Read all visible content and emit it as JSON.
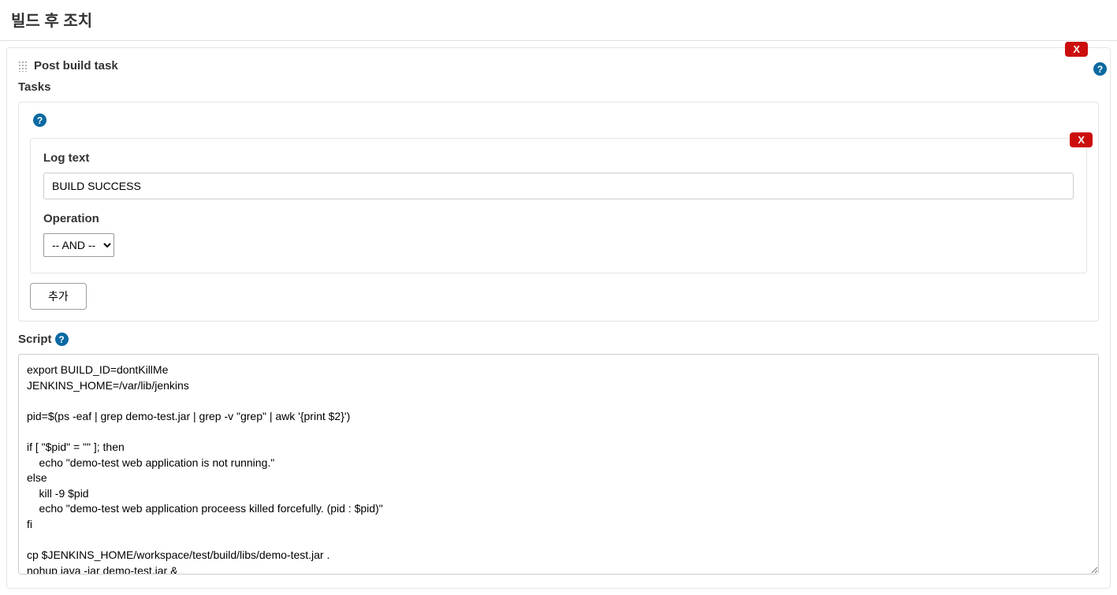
{
  "section": {
    "title": "빌드 후 조치"
  },
  "panel": {
    "title": "Post build task",
    "delete_label": "X",
    "tasks_label": "Tasks",
    "help_char": "?"
  },
  "log_block": {
    "delete_label": "X",
    "log_text_label": "Log text",
    "log_text_value": "BUILD SUCCESS",
    "operation_label": "Operation",
    "operation_value": "-- AND --"
  },
  "add_button_label": "추가",
  "script": {
    "label": "Script",
    "value": "export BUILD_ID=dontKillMe\nJENKINS_HOME=/var/lib/jenkins\n\npid=$(ps -eaf | grep demo-test.jar | grep -v \"grep\" | awk '{print $2}')\n\nif [ \"$pid\" = \"\" ]; then\n    echo \"demo-test web application is not running.\"\nelse\n    kill -9 $pid\n    echo \"demo-test web application proceess killed forcefully. (pid : $pid)\"\nfi\n\ncp $JENKINS_HOME/workspace/test/build/libs/demo-test.jar .\nnohup java -jar demo-test.jar &"
  }
}
